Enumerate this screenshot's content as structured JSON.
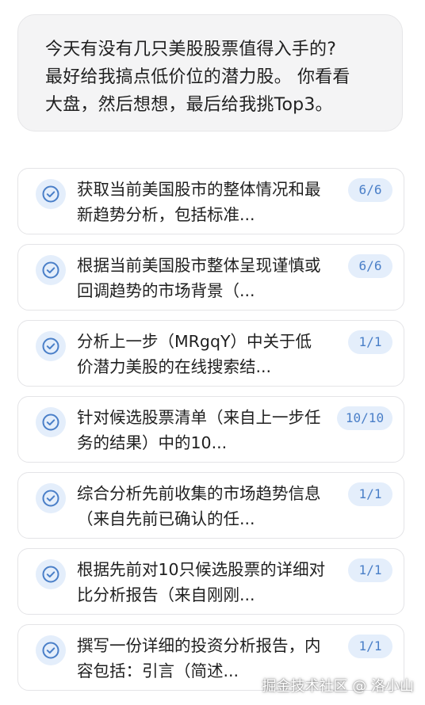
{
  "query": {
    "text": "今天有没有几只美股股票值得入手的?\n最好给我搞点低价位的潜力股。 你看看\n大盘，然后想想，最后给我挑Top3。"
  },
  "tasks": [
    {
      "icon": "check-circle-icon",
      "text": "获取当前美国股市的整体情况和最新趋势分析，包括标准...",
      "count": "6/6"
    },
    {
      "icon": "check-circle-icon",
      "text": "根据当前美国股市整体呈现谨慎或回调趋势的市场背景（...",
      "count": "6/6"
    },
    {
      "icon": "check-circle-icon",
      "text": "分析上一步（MRgqY）中关于低价潜力美股的在线搜索结...",
      "count": "1/1"
    },
    {
      "icon": "check-circle-icon",
      "text": "针对候选股票清单（来自上一步任务的结果）中的10...",
      "count": "10/10"
    },
    {
      "icon": "check-circle-icon",
      "text": "综合分析先前收集的市场趋势信息（来自先前已确认的任...",
      "count": "1/1"
    },
    {
      "icon": "check-circle-icon",
      "text": "根据先前对10只候选股票的详细对比分析报告（来自刚刚...",
      "count": "1/1"
    },
    {
      "icon": "check-circle-icon",
      "text": "撰写一份详细的投资分析报告，内容包括：引言（简述...",
      "count": "1/1"
    }
  ],
  "watermark": "掘金技术社区 @ 洛小山",
  "colors": {
    "accent": "#4a7fc8",
    "badge_bg": "#e4eefb",
    "bubble_bg": "#f4f4f5"
  }
}
